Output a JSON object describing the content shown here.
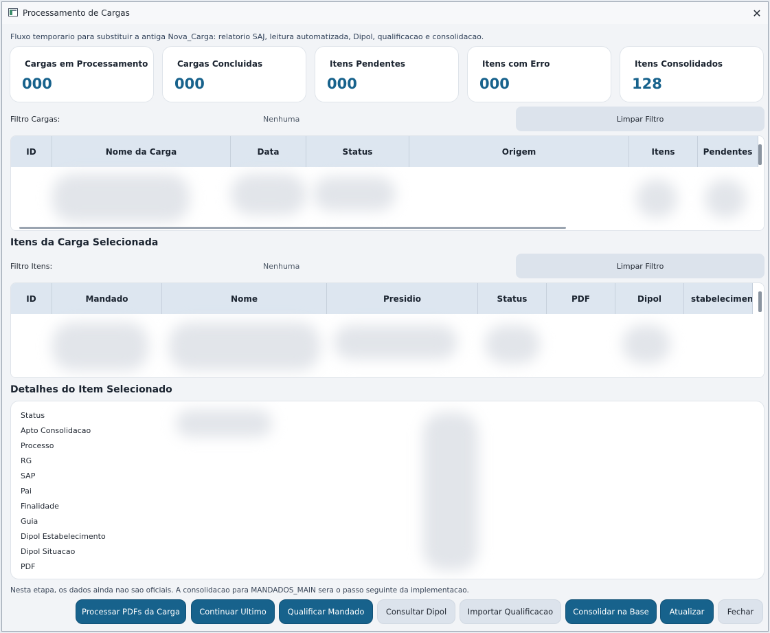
{
  "window": {
    "title": "Processamento de Cargas"
  },
  "subtitle": "Fluxo temporario para substituir a antiga Nova_Carga: relatorio SAJ, leitura automatizada, Dipol, qualificacao e consolidacao.",
  "stats": [
    {
      "label": "Cargas em Processamento",
      "value": "000"
    },
    {
      "label": "Cargas Concluidas",
      "value": "000"
    },
    {
      "label": "Itens Pendentes",
      "value": "000"
    },
    {
      "label": "Itens com Erro",
      "value": "000"
    },
    {
      "label": "Itens Consolidados",
      "value": "128"
    }
  ],
  "cargas_filter": {
    "label": "Filtro Cargas:",
    "value": "Nenhuma",
    "clear_label": "Limpar Filtro"
  },
  "cargas_table": {
    "columns": [
      "ID",
      "Nome da Carga",
      "Data",
      "Status",
      "Origem",
      "Itens",
      "Pendentes"
    ]
  },
  "itens_section_title": "Itens da Carga Selecionada",
  "itens_filter": {
    "label": "Filtro Itens:",
    "value": "Nenhuma",
    "clear_label": "Limpar Filtro"
  },
  "itens_table": {
    "columns": [
      "ID",
      "Mandado",
      "Nome",
      "Presidio",
      "Status",
      "PDF",
      "Dipol",
      "stabeleciment"
    ]
  },
  "details_section_title": "Detalhes do Item Selecionado",
  "details_fields": [
    "Status",
    "Apto Consolidacao",
    "Processo",
    "RG",
    "SAP",
    "Pai",
    "Finalidade",
    "Guia",
    "Dipol Estabelecimento",
    "Dipol Situacao",
    "PDF"
  ],
  "footnote": "Nesta etapa, os dados ainda nao sao oficiais. A consolidacao para MANDADOS_MAIN sera o passo seguinte da implementacao.",
  "buttons": {
    "processar": "Processar PDFs da Carga",
    "continuar": "Continuar Ultimo",
    "qualificar": "Qualificar Mandado",
    "consultar": "Consultar Dipol",
    "importar": "Importar Qualificacao",
    "consolidar": "Consolidar na Base",
    "atualizar": "Atualizar",
    "fechar": "Fechar"
  },
  "colors": {
    "accent": "#17628c",
    "header_bg": "#dde6f0",
    "secondary_btn": "#dce3ec"
  }
}
